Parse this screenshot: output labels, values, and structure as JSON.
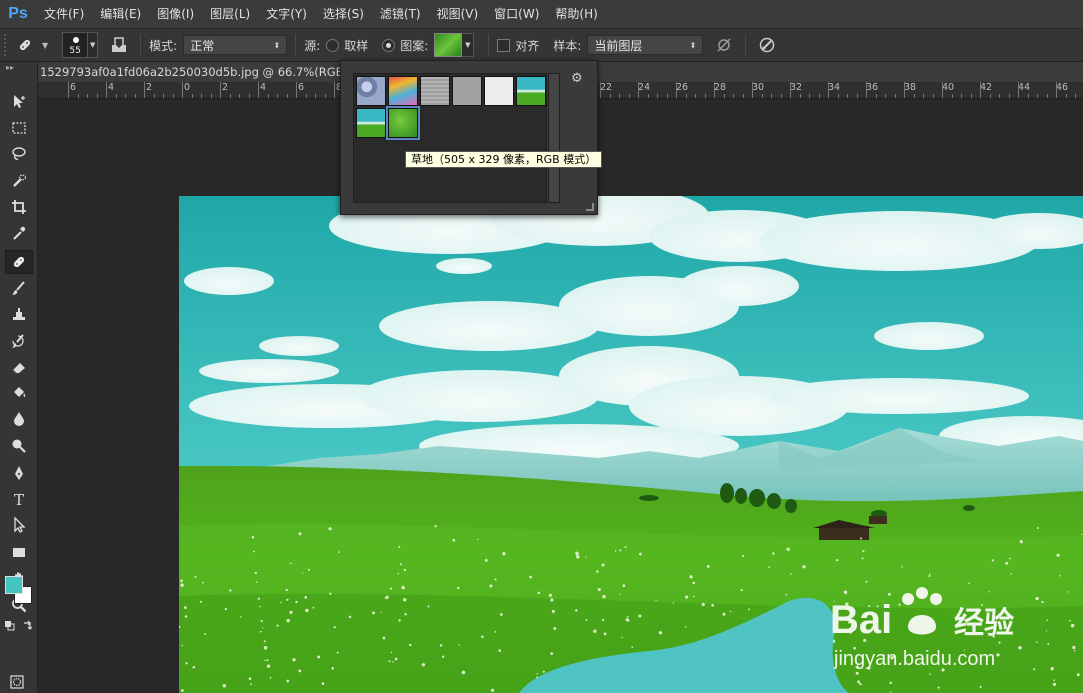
{
  "app": {
    "logo": "Ps"
  },
  "menu": [
    "文件(F)",
    "编辑(E)",
    "图像(I)",
    "图层(L)",
    "文字(Y)",
    "选择(S)",
    "滤镜(T)",
    "视图(V)",
    "窗口(W)",
    "帮助(H)"
  ],
  "options": {
    "brush_size": "55",
    "mode_label": "模式:",
    "mode_value": "正常",
    "source_label": "源:",
    "sampled_label": "取样",
    "pattern_label": "图案:",
    "aligned_label": "对齐",
    "sample_label": "样本:",
    "sample_value": "当前图层",
    "source_selected": "pattern",
    "aligned_checked": false
  },
  "document": {
    "tab_title": "1529793af0a1fd06a2b250030d5b.jpg @ 66.7%(RGB/8#",
    "ruler_labels": [
      "6",
      "4",
      "2",
      "0",
      "2",
      "4",
      "6",
      "8",
      "22",
      "24",
      "26",
      "28",
      "30",
      "32",
      "34",
      "36",
      "38",
      "40",
      "42",
      "44",
      "46"
    ]
  },
  "pattern_picker": {
    "tooltip": "草地（505 x 329 像素，RGB 模式）",
    "thumbnails": [
      "bubbles",
      "tie-dye",
      "gray-granite",
      "gray-solid",
      "white-solid",
      "landscape-1",
      "landscape-2",
      "grass"
    ],
    "selected_index": 7
  },
  "colors": {
    "foreground": "#46c2c0",
    "background": "#ffffff",
    "accent": "#4aa8ff"
  },
  "watermark": {
    "brand": "Bai经验",
    "url": "jingyan.baidu.com"
  }
}
